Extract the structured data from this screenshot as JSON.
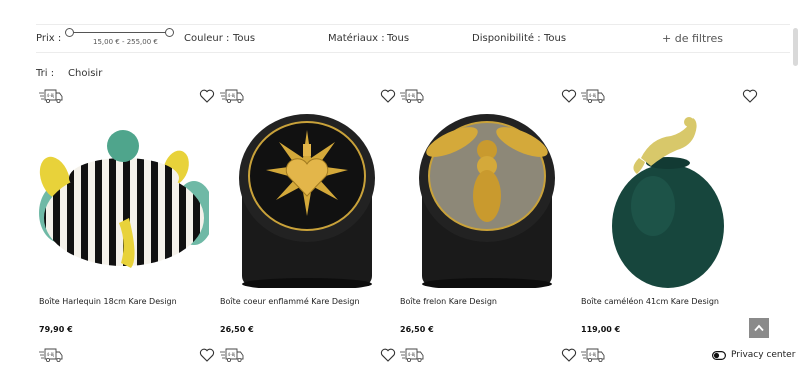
{
  "filters": {
    "price_label": "Prix :",
    "price_range": "15,00 € - 255,00 €",
    "color_label": "Couleur :",
    "color_value": "Tous",
    "material_label": "Matériaux :",
    "material_value": "Tous",
    "availability_label": "Disponibilité :",
    "availability_value": "Tous",
    "more_filters": "+ de filtres"
  },
  "sort": {
    "label": "Tri :",
    "value": "Choisir"
  },
  "delivery_badge": "4-8j",
  "products": [
    {
      "name": "Boîte Harlequin 18cm Kare Design",
      "price": "79,90 €"
    },
    {
      "name": "Boîte coeur enflammé Kare Design",
      "price": "26,50 €"
    },
    {
      "name": "Boîte frelon Kare Design",
      "price": "26,50 €"
    },
    {
      "name": "Boîte caméléon 41cm Kare Design",
      "price": "119,00 €"
    }
  ],
  "privacy": {
    "label": "Privacy center"
  },
  "colors": {
    "text": "#333333",
    "scroll_button": "#8a8a8a",
    "divider": "#ececec"
  },
  "icons": [
    "delivery-truck-icon",
    "heart-icon",
    "chevron-up-icon",
    "privacy-toggle-icon"
  ]
}
